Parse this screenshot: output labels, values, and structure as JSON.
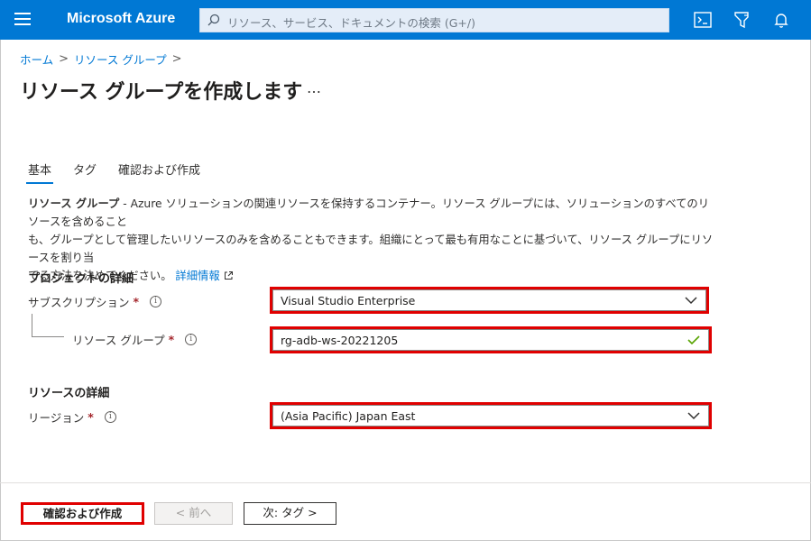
{
  "header": {
    "brand": "Microsoft Azure",
    "search_placeholder": "リソース、サービス、ドキュメントの検索 (G+/)",
    "icons": [
      "menu-icon",
      "search-icon",
      "cloud-shell-icon",
      "directory-filter-icon",
      "notifications-icon"
    ],
    "accent_color": "#0078d4"
  },
  "breadcrumb": {
    "home": "ホーム",
    "resource_groups": "リソース グループ"
  },
  "page": {
    "title": "リソース グループを作成します",
    "more": "…"
  },
  "tabs": [
    {
      "label": "基本",
      "active": true
    },
    {
      "label": "タグ",
      "active": false
    },
    {
      "label": "確認および作成",
      "active": false
    }
  ],
  "description": {
    "bold": "リソース グループ",
    "line1": " - Azure ソリューションの関連リソースを保持するコンテナー。リソース グループには、ソリューションのすべてのリソースを含めること",
    "line2": "も、グループとして管理したいリソースのみを含めることもできます。組織にとって最も有用なことに基づいて、リソース グループにリソースを割り当",
    "line3": "てる方法を決めてください。",
    "link": "詳細情報"
  },
  "project": {
    "heading": "プロジェクトの詳細",
    "subscription_label": "サブスクリプション",
    "subscription_value": "Visual Studio Enterprise",
    "resource_group_label": "リソース グループ",
    "resource_group_value": "rg-adb-ws-20221205"
  },
  "resource": {
    "heading": "リソースの詳細",
    "region_label": "リージョン",
    "region_value": "(Asia Pacific) Japan East"
  },
  "footer": {
    "review_create": "確認および作成",
    "previous": "< 前へ",
    "next": "次: タグ >"
  },
  "highlight_color": "#e00000"
}
